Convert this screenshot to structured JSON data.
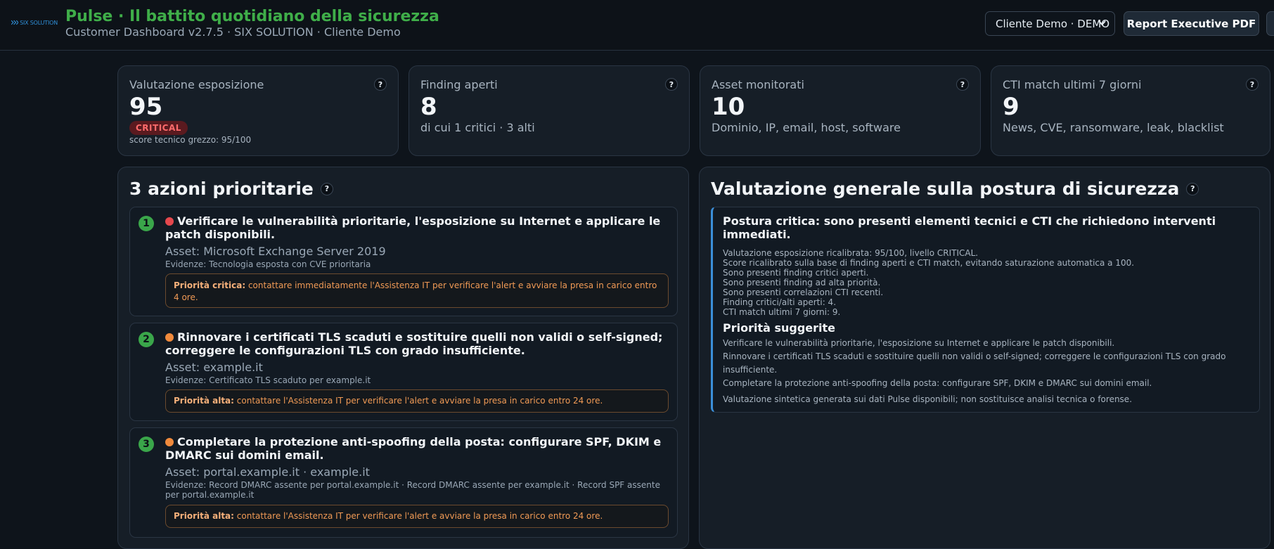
{
  "header": {
    "logo_text": "SIX SOLUTION",
    "title": "Pulse · Il battito quotidiano della sicurezza",
    "subtitle": "Customer Dashboard v2.7.5 · SIX SOLUTION · Cliente Demo",
    "client_select_value": "Cliente Demo · DEMO",
    "pdf_button": "Report Executive PDF"
  },
  "kpis": [
    {
      "label": "Valutazione esposizione",
      "value": "95",
      "badge": "CRITICAL",
      "note": "score tecnico grezzo: 95/100"
    },
    {
      "label": "Finding aperti",
      "value": "8",
      "sub": "di cui 1 critici · 3 alti"
    },
    {
      "label": "Asset monitorati",
      "value": "10",
      "sub": "Dominio, IP, email, host, software"
    },
    {
      "label": "CTI match ultimi 7 giorni",
      "value": "9",
      "sub": "News, CVE, ransomware, leak, blacklist"
    }
  ],
  "help_glyph": "?",
  "actions_panel": {
    "title": "3 azioni prioritarie",
    "items": [
      {
        "num": "1",
        "severity_color": "#e5484d",
        "title": "Verificare le vulnerabilità prioritarie, l'esposizione su Internet e applicare le patch disponibili.",
        "asset": "Asset: Microsoft Exchange Server 2019",
        "evidence": "Evidenze: Tecnologia esposta con CVE prioritaria",
        "priority_label": "Priorità critica:",
        "priority_text": " contattare immediatamente l'Assistenza IT per verificare l'alert e avviare la presa in carico entro 4 ore."
      },
      {
        "num": "2",
        "severity_color": "#f08a3c",
        "title": "Rinnovare i certificati TLS scaduti e sostituire quelli non validi o self-signed; correggere le configurazioni TLS con grado insufficiente.",
        "asset": "Asset: example.it",
        "evidence": "Evidenze: Certificato TLS scaduto per example.it",
        "priority_label": "Priorità alta:",
        "priority_text": " contattare l'Assistenza IT per verificare l'alert e avviare la presa in carico entro 24 ore."
      },
      {
        "num": "3",
        "severity_color": "#f08a3c",
        "title": "Completare la protezione anti-spoofing della posta: configurare SPF, DKIM e DMARC sui domini email.",
        "asset": "Asset: portal.example.it · example.it",
        "evidence": "Evidenze: Record DMARC assente per portal.example.it · Record DMARC assente per example.it · Record SPF assente per portal.example.it",
        "priority_label": "Priorità alta:",
        "priority_text": " contattare l'Assistenza IT per verificare l'alert e avviare la presa in carico entro 24 ore."
      }
    ]
  },
  "posture_panel": {
    "title": "Valutazione generale sulla postura di sicurezza",
    "headline": "Postura critica: sono presenti elementi tecnici e CTI che richiedono interventi immediati.",
    "lines": [
      "Valutazione esposizione ricalibrata: 95/100, livello CRITICAL.",
      "Score ricalibrato sulla base di finding aperti e CTI match, evitando saturazione automatica a 100.",
      "Sono presenti finding critici aperti.",
      "Sono presenti finding ad alta priorità.",
      "Sono presenti correlazioni CTI recenti.",
      "Finding critici/alti aperti: 4.",
      "CTI match ultimi 7 giorni: 9."
    ],
    "suggestions_title": "Priorità suggerite",
    "suggestions": [
      "Verificare le vulnerabilità prioritarie, l'esposizione su Internet e applicare le patch disponibili.",
      "Rinnovare i certificati TLS scaduti e sostituire quelli non validi o self-signed; correggere le configurazioni TLS con grado insufficiente.",
      "Completare la protezione anti-spoofing della posta: configurare SPF, DKIM e DMARC sui domini email."
    ],
    "note": "Valutazione sintetica generata sui dati Pulse disponibili; non sostituisce analisi tecnica o forense."
  }
}
